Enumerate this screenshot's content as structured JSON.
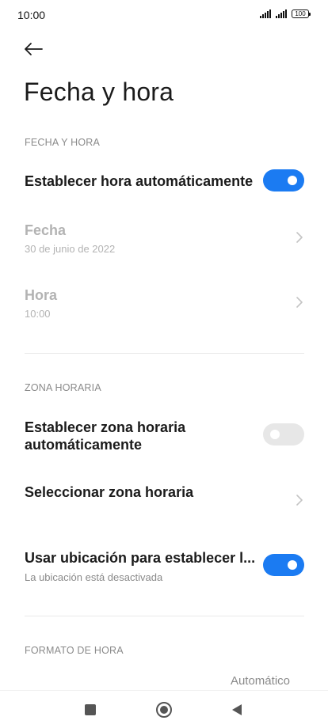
{
  "status_bar": {
    "time": "10:00",
    "battery": "100"
  },
  "header": {
    "title": "Fecha y hora"
  },
  "sections": {
    "date_time": {
      "header": "FECHA Y HORA",
      "auto_time": {
        "title": "Establecer hora automáticamente",
        "enabled": true
      },
      "date": {
        "title": "Fecha",
        "value": "30 de junio de 2022"
      },
      "time": {
        "title": "Hora",
        "value": "10:00"
      }
    },
    "time_zone": {
      "header": "ZONA HORARIA",
      "auto_zone": {
        "title_line1": "Establecer zona horaria",
        "title_line2": "automáticamente",
        "enabled": false
      },
      "select_zone": {
        "title": "Seleccionar zona horaria"
      },
      "use_location": {
        "title": "Usar ubicación para establecer l...",
        "subtitle": "La ubicación está desactivada",
        "enabled": true
      }
    },
    "time_format": {
      "header": "FORMATO DE HORA",
      "value": "Automático"
    }
  },
  "colors": {
    "accent": "#1b7bf2",
    "toggle_off": "#e7e7e7",
    "disabled_text": "#b3b3b3",
    "secondary_text": "#8a8a8a"
  },
  "icons": {
    "back": "arrow-left-icon",
    "chevron": "chevron-right-icon",
    "nav_recents": "square-icon",
    "nav_home": "circle-icon",
    "nav_back": "triangle-left-icon"
  }
}
